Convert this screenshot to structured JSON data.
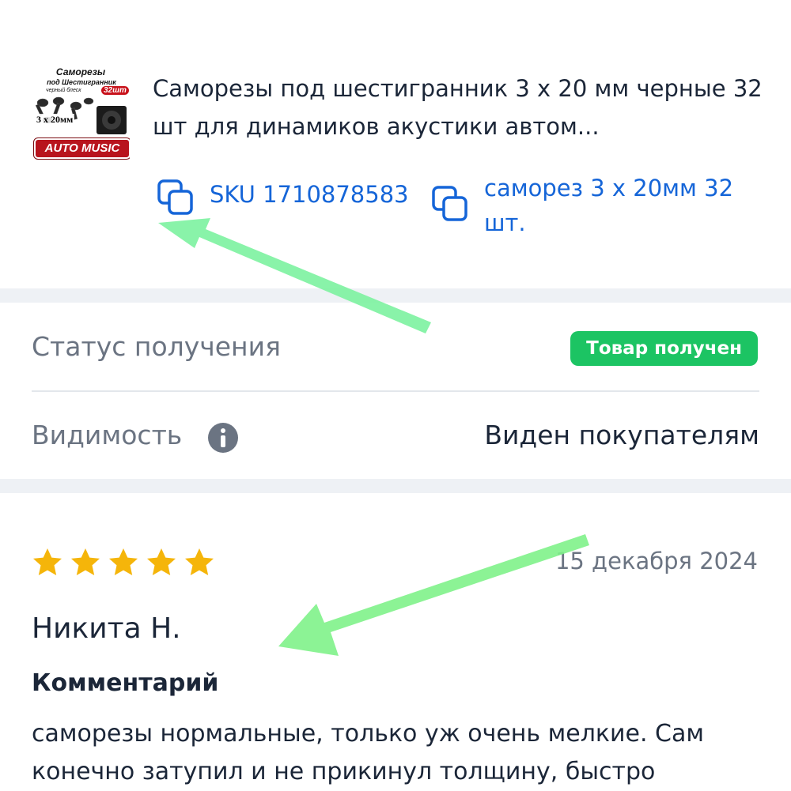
{
  "product": {
    "title": "Саморезы под шестигранник 3 x 20 мм черные 32 шт для динамиков акустики автом...",
    "image": {
      "line1": "Саморезы",
      "line2": "под Шестигранник",
      "line3": "черный блеск",
      "count_badge": "32шт",
      "size": "3 x 20мм",
      "brand": "AUTO MUSIC"
    },
    "sku": "SKU 1710878583",
    "variant": "саморез 3 x 20мм 32 шт."
  },
  "status": {
    "label": "Статус получения",
    "value": "Товар получен",
    "color": "#1cc463"
  },
  "visibility": {
    "label": "Видимость",
    "value": "Виден покупателям"
  },
  "review": {
    "rating": 5,
    "rating_max": 5,
    "date": "15 декабря 2024",
    "author": "Никита Н.",
    "comment_label": "Комментарий",
    "comment": "саморезы нормальные, только уж очень мелкие. Сам конечно затупил и не прикинул толщину, быстро"
  },
  "colors": {
    "accent": "#1565d8",
    "text": "#1b2638",
    "muted": "#6b7482",
    "star": "#f5b50a",
    "annotation_arrow": "#7cf2a0"
  },
  "icons": {
    "copy": "copy-icon",
    "info": "info-icon",
    "star": "star-icon",
    "back": "chevron-left-icon"
  }
}
